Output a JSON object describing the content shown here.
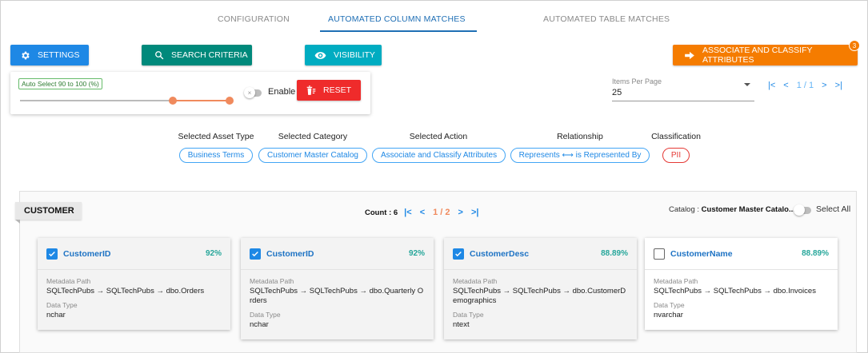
{
  "tabs": [
    {
      "label": "CONFIGURATION"
    },
    {
      "label": "AUTOMATED COLUMN MATCHES"
    },
    {
      "label": "AUTOMATED TABLE MATCHES"
    }
  ],
  "toolbar": {
    "settings_label": "SETTINGS",
    "search_label": "SEARCH CRITERIA",
    "visibility_label": "VISIBILITY",
    "associate_label": "ASSOCIATE AND CLASSIFY ATTRIBUTES",
    "associate_badge": "3"
  },
  "auto_select": {
    "label": "Auto Select 90 to 100 (%)",
    "range_low_percent": 90,
    "range_high_percent": 100,
    "toggle_mark": "×",
    "enable_label": "Enable",
    "reset_label": "RESET"
  },
  "pagination": {
    "items_per_page_label": "Items Per Page",
    "items_per_page_value": "25",
    "first": "|<",
    "prev": "<",
    "page_text": "1 / 1",
    "next": ">",
    "last": ">|"
  },
  "filters": [
    {
      "label": "Selected Asset Type",
      "value": "Business Terms"
    },
    {
      "label": "Selected Category",
      "value": "Customer Master Catalog"
    },
    {
      "label": "Selected Action",
      "value": "Associate and Classify Attributes"
    },
    {
      "label": "Relationship",
      "value": "Represents ⟷ is Represented By"
    },
    {
      "label": "Classification",
      "value": "PII"
    }
  ],
  "section": {
    "title": "CUSTOMER",
    "count_text": "Count : 6",
    "first": "|<",
    "prev": "<",
    "page_text": "1 / 2",
    "next": ">",
    "last": ">|",
    "catalog_label": "Catalog : ",
    "catalog_value": "Customer Master Catalo...",
    "select_all_label": "Select All"
  },
  "cards": [
    {
      "name": "CustomerID",
      "score": "92%",
      "checked": true,
      "metadata_label": "Metadata Path",
      "metadata_path": "SQLTechPubs → SQLTechPubs → dbo.Orders",
      "datatype_label": "Data Type",
      "datatype": "nchar"
    },
    {
      "name": "CustomerID",
      "score": "92%",
      "checked": true,
      "metadata_label": "Metadata Path",
      "metadata_path": "SQLTechPubs → SQLTechPubs → dbo.Quarterly Orders",
      "datatype_label": "Data Type",
      "datatype": "nchar"
    },
    {
      "name": "CustomerDesc",
      "score": "88.89%",
      "checked": true,
      "metadata_label": "Metadata Path",
      "metadata_path": "SQLTechPubs → SQLTechPubs → dbo.CustomerDemographics",
      "datatype_label": "Data Type",
      "datatype": "ntext"
    },
    {
      "name": "CustomerName",
      "score": "88.89%",
      "checked": false,
      "metadata_label": "Metadata Path",
      "metadata_path": "SQLTechPubs → SQLTechPubs → dbo.Invoices",
      "datatype_label": "Data Type",
      "datatype": "nvarchar"
    }
  ],
  "colors": {
    "primary": "#1e88e5",
    "teal": "#00897b",
    "cyan": "#00acc1",
    "orange": "#f57c00",
    "reset_red": "#ef2b2b",
    "score_green": "#26a69a",
    "slider_orange": "#f08a5d"
  }
}
